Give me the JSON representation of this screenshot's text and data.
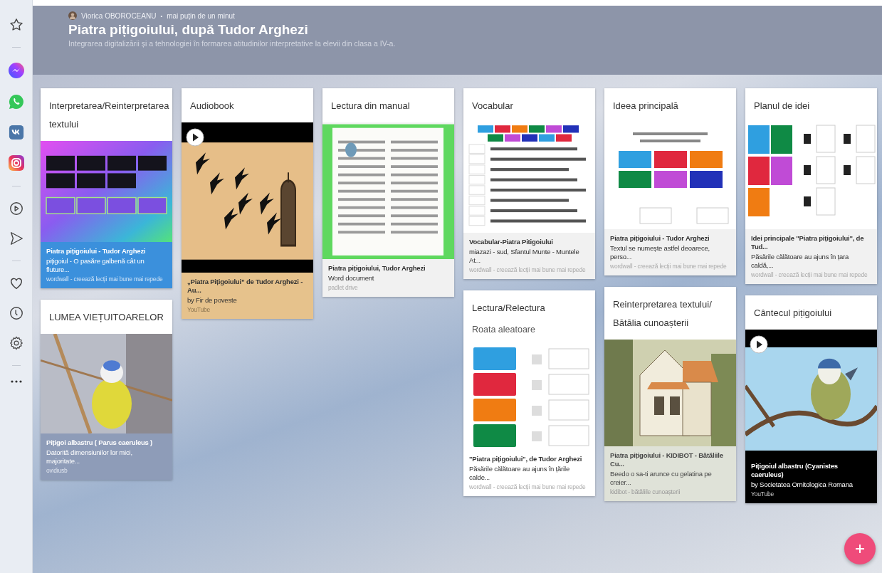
{
  "sidebar": {
    "items": [
      {
        "kind": "star"
      },
      {
        "kind": "divider"
      },
      {
        "kind": "messenger"
      },
      {
        "kind": "whatsapp"
      },
      {
        "kind": "vk"
      },
      {
        "kind": "instagram"
      },
      {
        "kind": "divider"
      },
      {
        "kind": "play"
      },
      {
        "kind": "send"
      },
      {
        "kind": "divider"
      },
      {
        "kind": "heart"
      },
      {
        "kind": "clock"
      },
      {
        "kind": "settings"
      },
      {
        "kind": "divider"
      },
      {
        "kind": "more"
      }
    ]
  },
  "header": {
    "author": "Viorica OBOROCEANU",
    "separator": "•",
    "time": "mai puțin de un minut",
    "title": "Piatra pițigoiului, după Tudor Arghezi",
    "subtitle": "Integrarea digitalizării și a tehnologiei în formarea atitudinilor interpretative la elevii din clasa a IV-a."
  },
  "columns": [
    {
      "cards": [
        {
          "title": "Interpretarea/Reinterpretarea textului",
          "preview": {
            "kind": "quiz-grid"
          },
          "attachment": {
            "kind": "blue",
            "title": "Piatra pițigoiului - Tudor Arghezi",
            "description": "pițigoiul - O pasăre galbenă cât un fluture...",
            "source": "wordwall - creează lecții mai bune mai repede"
          }
        },
        {
          "title": "LUMEA VIEȚUITOARELOR",
          "preview": {
            "kind": "bird-photo"
          },
          "attachment": {
            "kind": "slate",
            "title": "Pițigoi albastru ( Parus caeruleus )",
            "description": "Datorită dimensiunilor lor mici, majoritate...",
            "source": "ovidiusb"
          }
        }
      ]
    },
    {
      "cards": [
        {
          "title": "Audiobook",
          "preview": {
            "kind": "audiobook"
          },
          "attachment": {
            "kind": "tan",
            "title": "„Piatra Pițigoiului” de Tudor Arghezi - Au...",
            "description": "by Fir de poveste",
            "source": "YouTube"
          }
        }
      ]
    },
    {
      "cards": [
        {
          "title": "Lectura din manual",
          "preview": {
            "kind": "document"
          },
          "attachment": {
            "kind": "light",
            "title": "Piatra pițigoiului, Tudor Arghezi",
            "description": "Word document",
            "source": "padlet drive"
          }
        }
      ]
    },
    {
      "cards": [
        {
          "title": "Vocabular",
          "preview": {
            "kind": "word-list"
          },
          "attachment": {
            "kind": "light",
            "title": "Vocabular-Piatra Pitigoiului",
            "description": "miazazi - sud, Sfantul Munte - Muntele At...",
            "source": "wordwall - creează lecții mai bune mai repede"
          }
        },
        {
          "title": "Lectura/Relectura",
          "body": "Roata aleatoare",
          "preview": {
            "kind": "ranking"
          },
          "attachment": {
            "kind": "white",
            "title": "\"Piatra pițigoiului\", de Tudor Arghezi",
            "description": "Păsările călătoare au ajuns în țările calde...",
            "source": "wordwall - creează lecții mai bune mai repede"
          }
        }
      ]
    },
    {
      "cards": [
        {
          "title": "Ideea principală",
          "preview": {
            "kind": "match"
          },
          "attachment": {
            "kind": "light",
            "title": "Piatra pițigoiului - Tudor Arghezi",
            "description": "Textul se numește astfel deoarece, perso...",
            "source": "wordwall - creează lecții mai bune mai repede"
          }
        },
        {
          "title": "Reinterpretarea textului/ Bătălia cunoașterii",
          "preview": {
            "kind": "house"
          },
          "attachment": {
            "kind": "sage",
            "title": "Piatra pițigoiului - KIDIBOT - Bătăliile Cu...",
            "description": "Beedo o sa-ti arunce cu gelatina pe creier...",
            "source": "kidibot - bătăliile cunoașterii"
          }
        }
      ]
    },
    {
      "cards": [
        {
          "title": "Planul de idei",
          "preview": {
            "kind": "numbered"
          },
          "attachment": {
            "kind": "light",
            "title": "Idei principale \"Piatra pițigoiului\", de Tud...",
            "description": "Păsările călătoare au ajuns în țara caldă,...",
            "source": "wordwall - creează lecții mai bune mai repede"
          }
        },
        {
          "title": "Cântecul pițigoiului",
          "preview": {
            "kind": "bird-video"
          },
          "attachment": {
            "kind": "dark",
            "title": "Pițigoiul albastru (Cyanistes caeruleus)",
            "description": "by Societatea Ornitologica Romana",
            "source": "YouTube"
          }
        }
      ]
    }
  ]
}
